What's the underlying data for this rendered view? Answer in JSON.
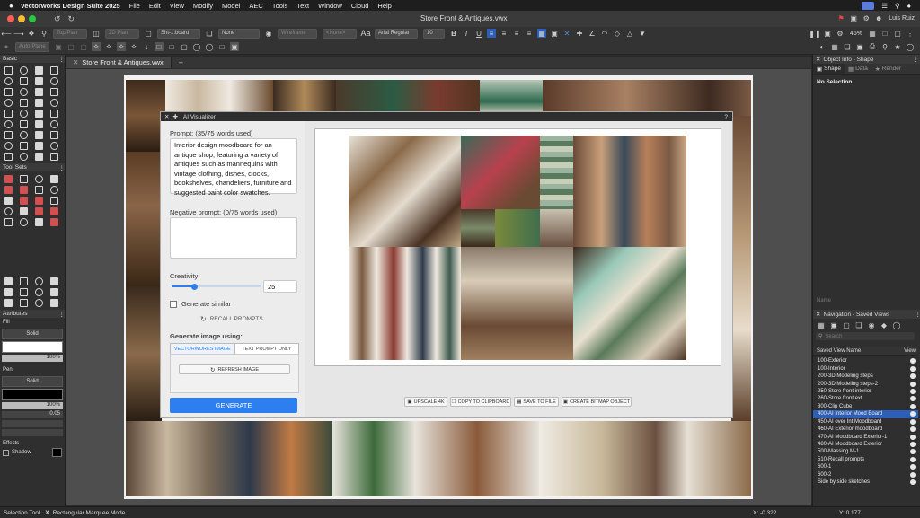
{
  "menubar": {
    "app": "Vectorworks Design Suite 2025",
    "menus": [
      "File",
      "Edit",
      "View",
      "Modify",
      "Model",
      "AEC",
      "Tools",
      "Text",
      "Window",
      "Cloud",
      "Help"
    ],
    "user": "Luis Ruiz"
  },
  "window": {
    "title": "Store Front & Antiques.vwx"
  },
  "toolbar1": {
    "view_mode": "Top/Plan",
    "projection": "2D Plan",
    "sheet_layer": "Sht-...board",
    "class": "None",
    "render_mode": "Wireframe",
    "none2": "<None>",
    "font": "Arial Regular",
    "font_size": "10",
    "zoom": "46%"
  },
  "toolbar2": {
    "auto_plane": "Auto-Plane"
  },
  "left_palette": {
    "basic_title": "Basic",
    "toolsets_title": "Tool Sets",
    "attributes_title": "Attributes",
    "fill_label": "Fill",
    "fill_style": "Solid",
    "fill_opacity": "100%",
    "pen_label": "Pen",
    "pen_style": "Solid",
    "pen_opacity": "100%",
    "pen_thickness": "0.05",
    "effects_label": "Effects",
    "shadow_label": "Shadow"
  },
  "document_tab": {
    "label": "Store Front & Antiques.vwx",
    "add": "+"
  },
  "dialog": {
    "title": "AI Visualizer",
    "help": "?",
    "prompt_label": "Prompt: (35/75 words used)",
    "prompt_text": "Interior design moodboard for an antique shop, featuring a variety of antiques such as mannequins with vintage clothing, dishes, clocks, bookshelves, chandeliers, furniture and suggested paint color swatches.",
    "negative_label": "Negative prompt: (0/75 words used)",
    "negative_text": "",
    "creativity_label": "Creativity",
    "creativity_value": "25",
    "creativity_fraction": 0.25,
    "generate_similar_label": "Generate similar",
    "recall_label": "RECALL PROMPTS",
    "generate_using_label": "Generate image using:",
    "tab_vectorworks": "VECTORWORKS IMAGE",
    "tab_text": "TEXT PROMPT ONLY",
    "refresh_label": "REFRESH IMAGE",
    "generate_label": "GENERATE",
    "upscale_label": "UPSCALE 4K",
    "clipboard_label": "COPY TO CLIPBOARD",
    "save_label": "SAVE TO FILE",
    "bitmap_label": "CREATE BITMAP OBJECT"
  },
  "object_info": {
    "title": "Object Info - Shape",
    "tabs": [
      "Shape",
      "Data",
      "Render"
    ],
    "selection": "No Selection",
    "name_label": "Name"
  },
  "navigation": {
    "title": "Navigation - Saved Views",
    "search_placeholder": "Search",
    "col_name": "Saved View Name",
    "col_view": "View",
    "views": [
      "100-Exterior",
      "100-Interior",
      "200-3D Modeling steps",
      "200-3D Modeling steps-2",
      "250-Store front interior",
      "260-Store front ext",
      "300-Clip Cube",
      "400-AI Interior Mood Board",
      "450-AI over Int Moodboard",
      "460-AI Exterior moodboard",
      "470-AI Moodboard Exterior-1",
      "480-AI Moodboard Exterior",
      "500-Massing M-1",
      "510-Recall prompts",
      "600-1",
      "600-2",
      "Side by side sketches"
    ],
    "selected_index": 7
  },
  "colors": {
    "accent": "#2d7ff0",
    "selection": "#2d5fb8",
    "menubar": "#1e1e1e",
    "panel": "#2f2f2f"
  },
  "statusbar": {
    "tool": "Selection Tool",
    "mode_key": "X",
    "mode": "Rectangular Marquee Mode",
    "x": "X: -0.322",
    "y": "Y: 0.177"
  }
}
